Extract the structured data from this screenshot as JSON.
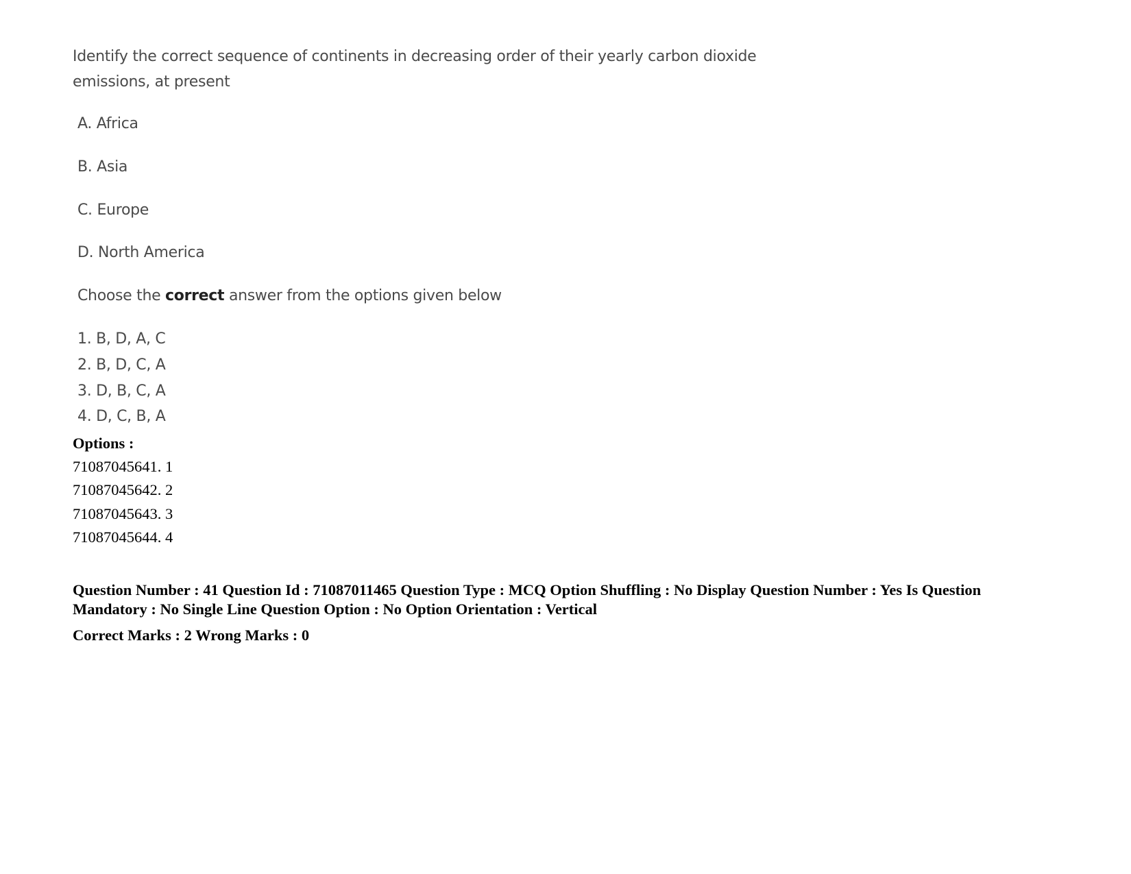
{
  "question": {
    "stem": "Identify the correct sequence of continents in decreasing order of their yearly carbon dioxide emissions, at present",
    "items": [
      "A. Africa",
      "B. Asia",
      "C. Europe",
      "D. North America"
    ],
    "instruction_pre": "Choose the ",
    "instruction_bold": "correct",
    "instruction_post": " answer from the options given below",
    "choices": [
      "1. B, D, A, C",
      "2. B, D, C, A",
      "3. D, B, C, A",
      "4. D, C, B, A"
    ]
  },
  "options": {
    "label": "Options :",
    "list": [
      "71087045641. 1",
      "71087045642. 2",
      "71087045643. 3",
      "71087045644. 4"
    ]
  },
  "meta": {
    "line": "Question Number : 41 Question Id : 71087011465 Question Type : MCQ Option Shuffling : No Display Question Number : Yes Is Question Mandatory : No Single Line Question Option : No Option Orientation : Vertical",
    "marks": "Correct Marks : 2 Wrong Marks : 0"
  }
}
